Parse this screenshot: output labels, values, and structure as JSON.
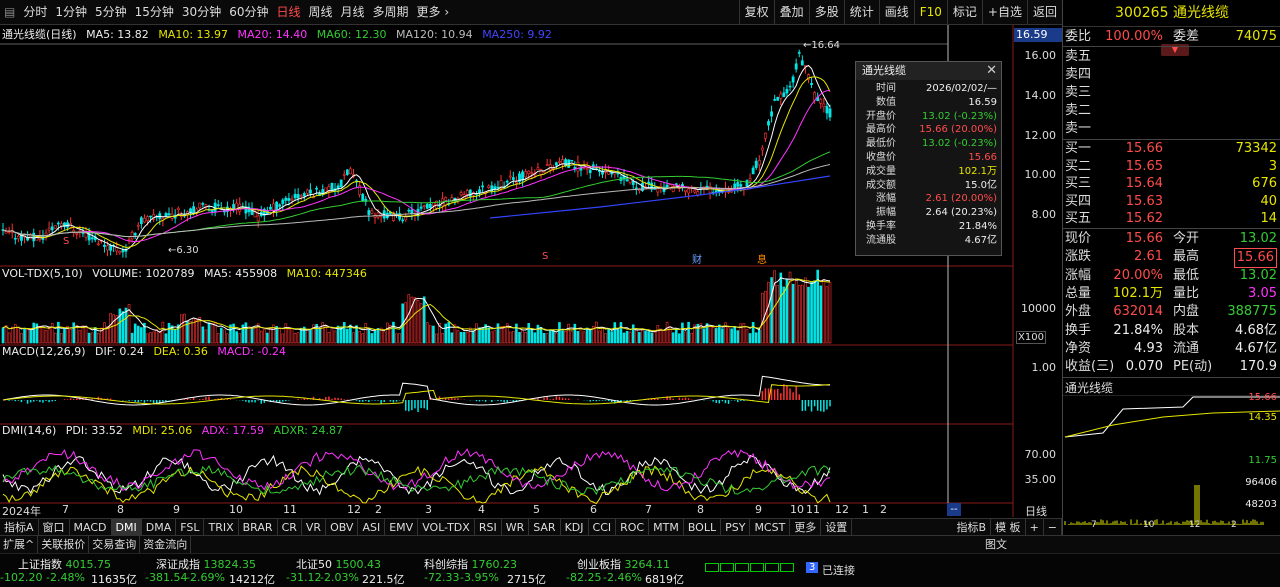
{
  "toolbar": {
    "periods": [
      "分时",
      "1分钟",
      "5分钟",
      "15分钟",
      "30分钟",
      "60分钟",
      "日线",
      "周线",
      "月线",
      "多周期",
      "更多"
    ],
    "active_period": "日线",
    "right": [
      "复权",
      "叠加",
      "多股",
      "统计",
      "画线",
      "F10",
      "标记",
      "+自选",
      "返回"
    ]
  },
  "main_legend": {
    "name": "通光线缆(日线)",
    "ma5": "MA5: 13.82",
    "ma10": "MA10: 13.97",
    "ma20": "MA20: 14.40",
    "ma60": "MA60: 12.30",
    "ma120": "MA120: 10.94",
    "ma250": "MA250: 9.92"
  },
  "main_axis": {
    "current_price": "16.59",
    "ticks": [
      "16.00",
      "14.00",
      "12.00",
      "10.00",
      "8.00"
    ],
    "high_mark": "16.64",
    "low_mark": "6.30"
  },
  "vol_legend": {
    "name": "VOL-TDX(5,10)",
    "volume": "VOLUME: 1020789",
    "ma5": "MA5: 455908",
    "ma10": "MA10: 447346",
    "tick": "10000",
    "unit": "X100"
  },
  "macd_legend": {
    "name": "MACD(12,26,9)",
    "dif": "DIF: 0.24",
    "dea": "DEA: 0.36",
    "macd": "MACD: -0.24",
    "tick": "1.00"
  },
  "dmi_legend": {
    "name": "DMI(14,6)",
    "pdi": "PDI: 33.52",
    "mdi": "MDI: 25.06",
    "adx": "ADX: 17.59",
    "adxr": "ADXR: 24.87",
    "ticks": [
      "70.00",
      "35.00"
    ]
  },
  "x_axis": {
    "labels": [
      "2024年",
      "7",
      "8",
      "9",
      "10",
      "11",
      "12",
      "2",
      "3",
      "4",
      "5",
      "6",
      "7",
      "8",
      "9",
      "10",
      "11",
      "12",
      "1",
      "2"
    ],
    "cursor": "--",
    "mode": "日线"
  },
  "markers": {
    "s": "S",
    "cai": "财",
    "xi": "息"
  },
  "indicators": [
    "指标A",
    "窗口",
    "MACD",
    "DMI",
    "DMA",
    "FSL",
    "TRIX",
    "BRAR",
    "CR",
    "VR",
    "OBV",
    "ASI",
    "EMV",
    "VOL-TDX",
    "RSI",
    "WR",
    "SAR",
    "KDJ",
    "CCI",
    "ROC",
    "MTM",
    "BOLL",
    "PSY",
    "MCST",
    "更多",
    "设置"
  ],
  "indicator_right": [
    "指标B",
    "模 板",
    "+",
    "−"
  ],
  "tabs2": [
    "扩展^",
    "关联报价",
    "交易查询",
    "资金流向"
  ],
  "tabs2_right": "图文",
  "popup": {
    "title": "通光线缆",
    "rows": [
      {
        "l": "时间",
        "v": "2026/02/02/—",
        "c": "white"
      },
      {
        "l": "数值",
        "v": "16.59",
        "c": "white"
      },
      {
        "l": "开盘价",
        "v": "13.02 (-0.23%)",
        "c": "green"
      },
      {
        "l": "最高价",
        "v": "15.66 (20.00%)",
        "c": "red"
      },
      {
        "l": "最低价",
        "v": "13.02 (-0.23%)",
        "c": "green"
      },
      {
        "l": "收盘价",
        "v": "15.66",
        "c": "red"
      },
      {
        "l": "成交量",
        "v": "102.1万",
        "c": "yellow"
      },
      {
        "l": "成交额",
        "v": "15.0亿",
        "c": "white"
      },
      {
        "l": "涨幅",
        "v": "2.61 (20.00%)",
        "c": "red"
      },
      {
        "l": "振幅",
        "v": "2.64 (20.23%)",
        "c": "white"
      },
      {
        "l": "换手率",
        "v": "21.84%",
        "c": "white"
      },
      {
        "l": "流通股",
        "v": "4.67亿",
        "c": "white"
      }
    ]
  },
  "side": {
    "title": "300265 通光线缆",
    "weibi_l": "委比",
    "weibi_v": "100.00%",
    "weicha_l": "委差",
    "weicha_v": "74075",
    "sells": [
      {
        "l": "卖五"
      },
      {
        "l": "卖四"
      },
      {
        "l": "卖三"
      },
      {
        "l": "卖二"
      },
      {
        "l": "卖一"
      }
    ],
    "buys": [
      {
        "l": "买一",
        "p": "15.66",
        "q": "73342"
      },
      {
        "l": "买二",
        "p": "15.65",
        "q": "3"
      },
      {
        "l": "买三",
        "p": "15.64",
        "q": "676"
      },
      {
        "l": "买四",
        "p": "15.63",
        "q": "40"
      },
      {
        "l": "买五",
        "p": "15.62",
        "q": "14"
      }
    ],
    "stats": [
      {
        "l1": "现价",
        "v1": "15.66",
        "c1": "red",
        "l2": "今开",
        "v2": "13.02",
        "c2": "green"
      },
      {
        "l1": "涨跌",
        "v1": "2.61",
        "c1": "red",
        "l2": "最高",
        "v2": "15.66",
        "c2": "red"
      },
      {
        "l1": "涨幅",
        "v1": "20.00%",
        "c1": "red",
        "l2": "最低",
        "v2": "13.02",
        "c2": "green"
      },
      {
        "l1": "总量",
        "v1": "102.1万",
        "c1": "yellow",
        "l2": "量比",
        "v2": "3.05",
        "c2": "mag"
      },
      {
        "l1": "外盘",
        "v1": "632014",
        "c1": "red",
        "l2": "内盘",
        "v2": "388775",
        "c2": "green"
      },
      {
        "l1": "换手",
        "v1": "21.84%",
        "c1": "white",
        "l2": "股本",
        "v2": "4.68亿",
        "c2": "white"
      },
      {
        "l1": "净资",
        "v1": "4.93",
        "c1": "white",
        "l2": "流通",
        "v2": "4.67亿",
        "c2": "white"
      },
      {
        "l1": "收益(三)",
        "v1": "0.070",
        "c1": "white",
        "l2": "PE(动)",
        "v2": "170.9",
        "c2": "white"
      }
    ],
    "mini_title": "通光线缆",
    "mini_ticks": [
      "15.66",
      "14.35",
      "11.75",
      "96406",
      "48203"
    ],
    "mini_x": [
      "7",
      "10",
      "12",
      "2"
    ]
  },
  "ticker": {
    "row1": [
      {
        "name": "上证指数",
        "v": "4015.75",
        "c": "green"
      },
      {
        "name": "深证成指",
        "v": "13824.35",
        "c": "green"
      },
      {
        "name": "北证50",
        "v": "1500.43",
        "c": "green"
      },
      {
        "name": "科创综指",
        "v": "1760.23",
        "c": "green"
      },
      {
        "name": "创业板指",
        "v": "3264.11",
        "c": "green"
      }
    ],
    "row2": [
      "-102.20",
      "-2.48%",
      "11635亿",
      "-381.54",
      "-2.69%",
      "14212亿",
      "-31.12",
      "-2.03%",
      "221.5亿",
      "-72.33",
      "-3.95%",
      "2715亿",
      "-82.25",
      "-2.46%",
      "6819亿"
    ],
    "conn": "已连接",
    "conn_num": "3"
  }
}
